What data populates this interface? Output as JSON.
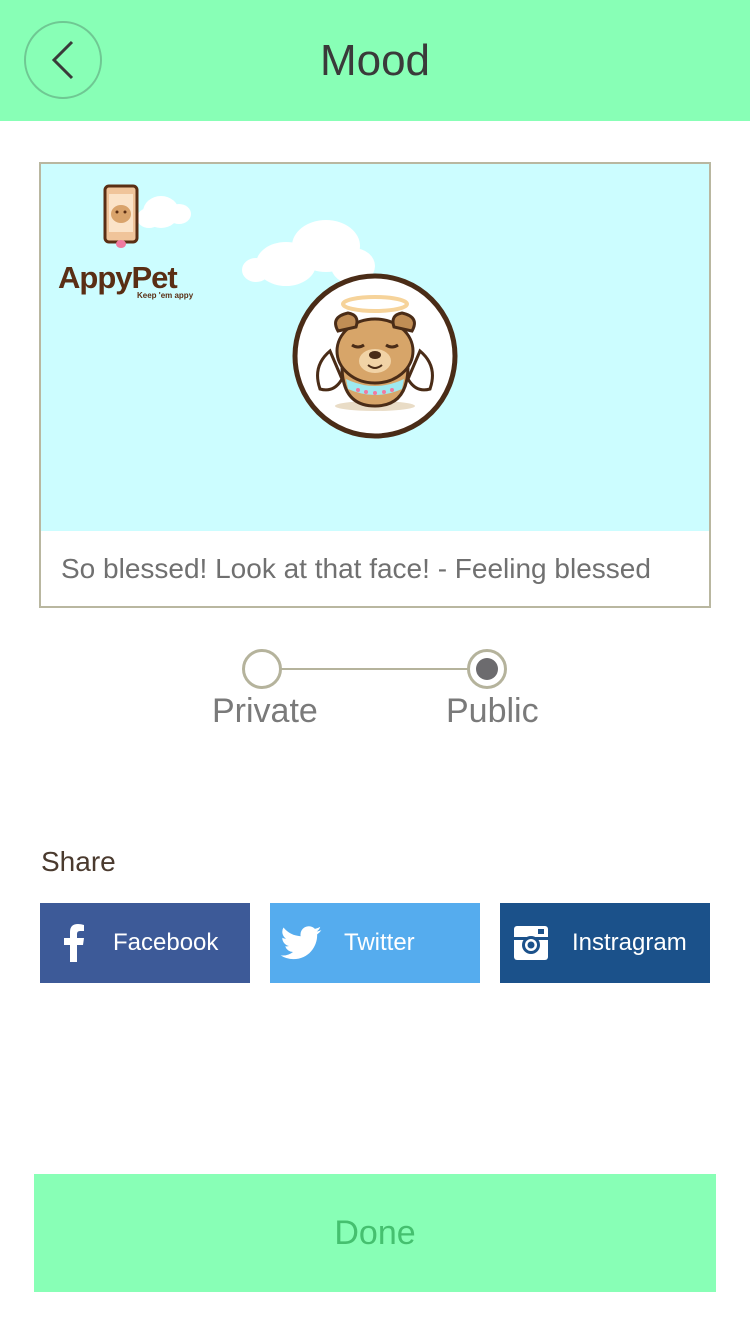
{
  "header": {
    "title": "Mood",
    "back_icon": "chevron-left-icon"
  },
  "post": {
    "brand_name": "AppyPet",
    "brand_tagline": "Keep 'em appy",
    "caption": "So blessed! Look at that face! - Feeling blessed"
  },
  "visibility": {
    "options": [
      {
        "label": "Private",
        "selected": false
      },
      {
        "label": "Public",
        "selected": true
      }
    ]
  },
  "share": {
    "label": "Share",
    "buttons": [
      {
        "label": "Facebook",
        "icon": "facebook-icon",
        "color": "#3d5a98"
      },
      {
        "label": "Twitter",
        "icon": "twitter-icon",
        "color": "#55acee"
      },
      {
        "label": "Instragram",
        "icon": "instagram-icon",
        "color": "#1b518a"
      }
    ]
  },
  "footer": {
    "done_label": "Done"
  },
  "colors": {
    "accent": "#88ffb6",
    "done_text": "#45c06f"
  }
}
